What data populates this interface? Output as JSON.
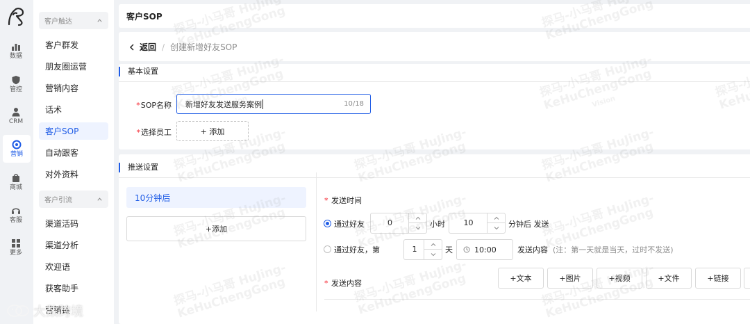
{
  "rail": {
    "items": [
      {
        "label": "数据",
        "icon": "chart-icon"
      },
      {
        "label": "管控",
        "icon": "shield-icon"
      },
      {
        "label": "CRM",
        "icon": "user-icon"
      },
      {
        "label": "营销",
        "icon": "target-icon"
      },
      {
        "label": "商城",
        "icon": "shop-icon"
      },
      {
        "label": "客服",
        "icon": "headset-icon"
      },
      {
        "label": "更多",
        "icon": "grid-icon"
      }
    ],
    "active": "营销"
  },
  "menu": {
    "group1": "客户触达",
    "group1_items": [
      "客户群发",
      "朋友圈运营",
      "营销内容",
      "话术",
      "客户SOP",
      "自动跟客",
      "对外资料"
    ],
    "group2": "客户引流",
    "group2_items": [
      "渠道活码",
      "渠道分析",
      "欢迎语",
      "获客助手",
      "营销链"
    ],
    "active": "客户SOP"
  },
  "header": {
    "title": "客户SOP"
  },
  "breadcrumb": {
    "back": "返回",
    "separator": "/",
    "current": "创建新增好友SOP"
  },
  "basic": {
    "section": "基本设置",
    "name_label": "SOP名称",
    "name_value": "新增好友发送服务案例",
    "name_count": "10/18",
    "staff_label": "选择员工",
    "staff_add": "+ 添加"
  },
  "push": {
    "section": "推送设置",
    "tab": "10分钟后",
    "add_tab": "+添加",
    "send_time_label": "发送时间",
    "opt1_label": "通过好友",
    "hours": "0",
    "hours_unit": "小时",
    "minutes": "10",
    "minutes_suffix": "分钟后 发送",
    "opt2_label": "通过好友，第",
    "day": "1",
    "day_unit": "天",
    "time": "10:00",
    "send_content_suffix": "发送内容",
    "note": "(注：第一天就是当天，过时不发送)",
    "content_label": "发送内容",
    "content_types": [
      "+文本",
      "+图片",
      "+视频",
      "+文件",
      "+链接"
    ]
  },
  "watermark": {
    "line1": "探马-小马哥 HuJing-",
    "line2": "KeHuChengGong",
    "line3": "Vision"
  },
  "footer": {
    "brand": "大数跨境"
  },
  "colors": {
    "accent": "#1f5ce6",
    "required": "#f5222d"
  }
}
